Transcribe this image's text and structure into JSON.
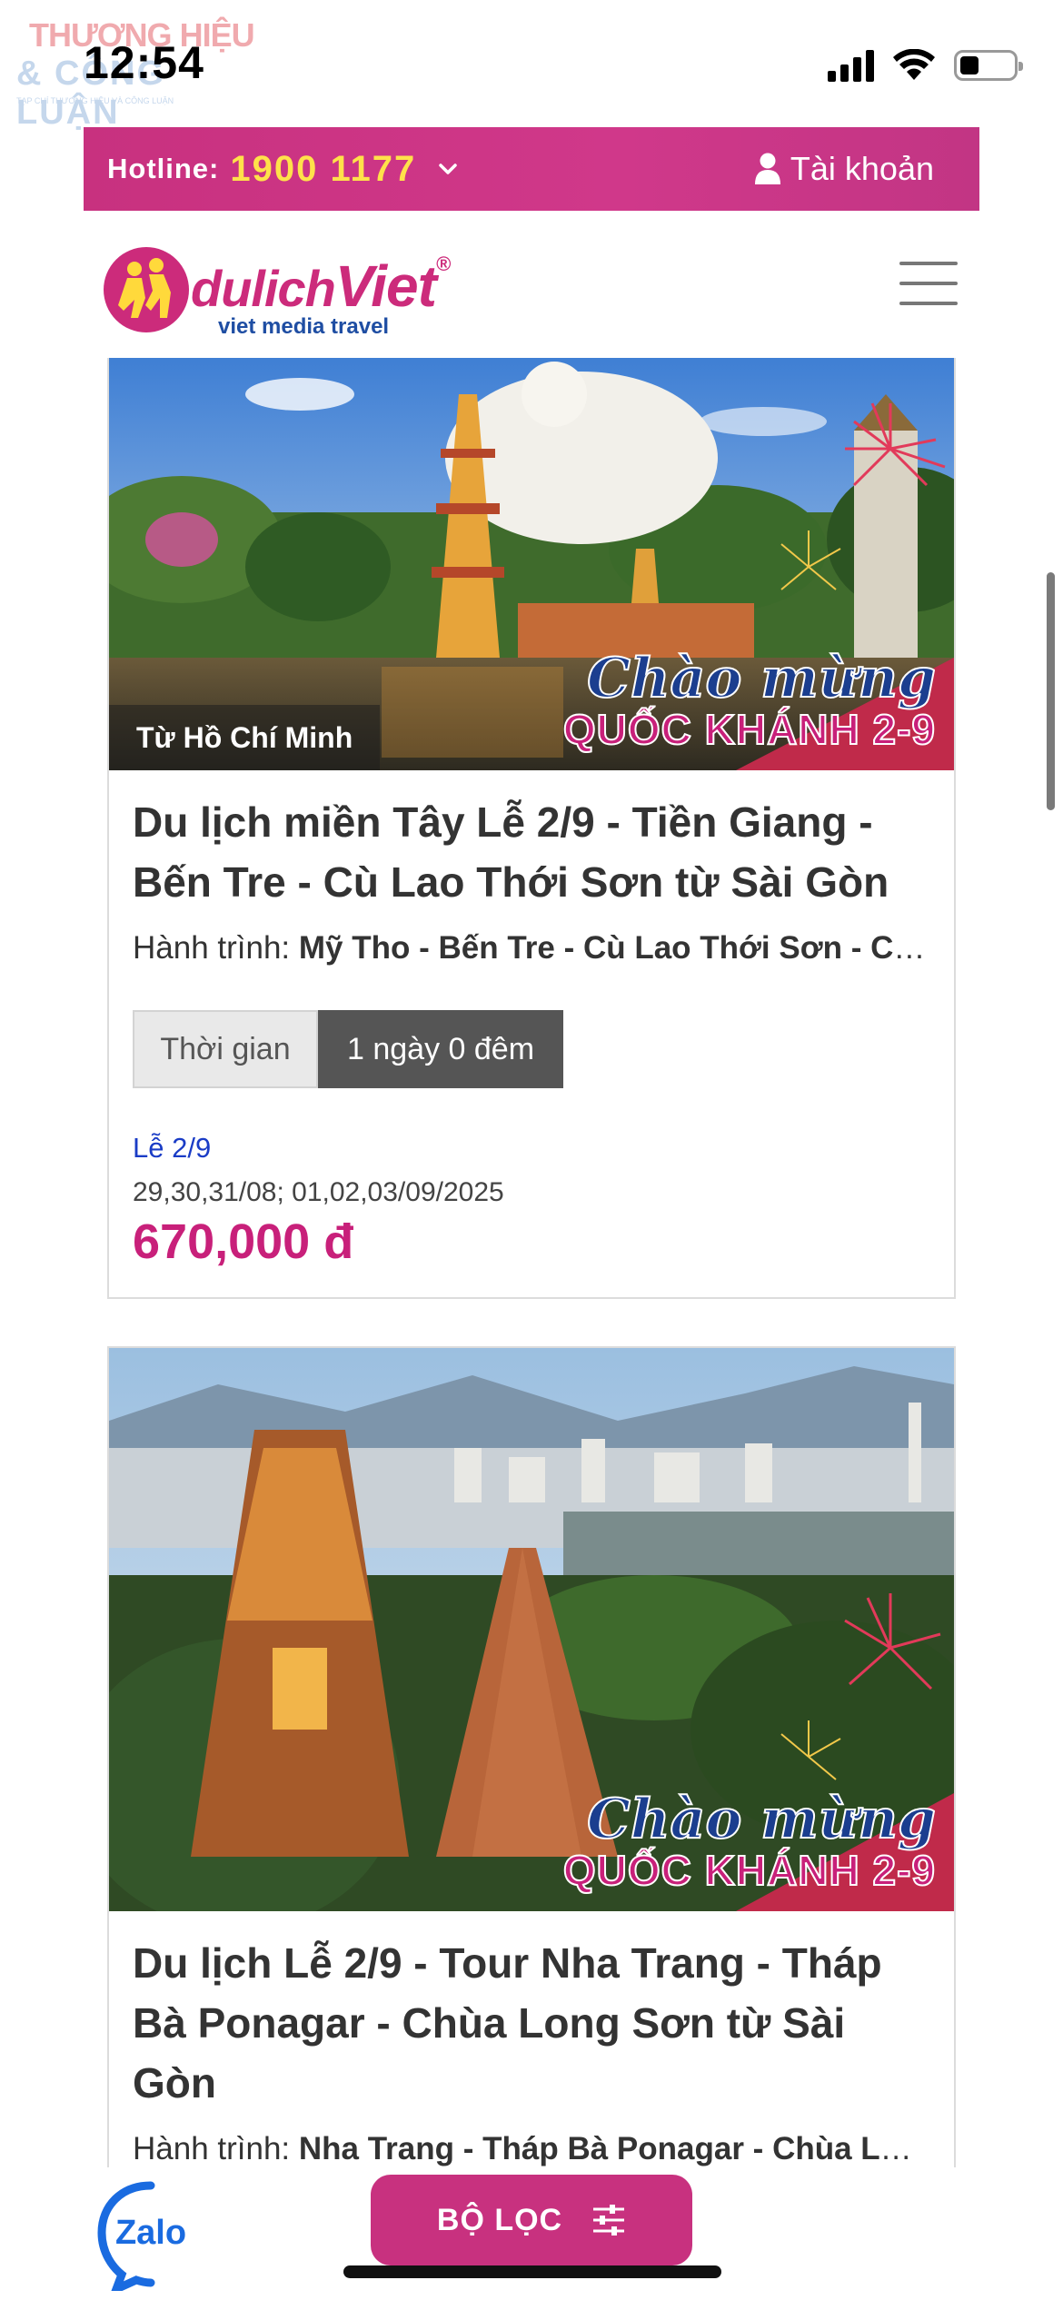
{
  "status_bar": {
    "time": "12:54",
    "watermark_line1": "THƯƠNG HIỆU",
    "watermark_line2": "& CÔNG LUẬN",
    "watermark_line3": "TẠP CHÍ THƯƠNG HIỆU VÀ CÔNG LUẬN",
    "battery_level": 0.35
  },
  "header": {
    "hotline_label": "Hotline:",
    "hotline_number": "1900 1177",
    "account_label": "Tài khoản",
    "logo_text_1": "dulich",
    "logo_text_2": "Viet",
    "logo_reg": "®",
    "logo_sub": "viet media travel"
  },
  "tours": [
    {
      "origin": "Từ Hồ Chí Minh",
      "promo_script": "Chào mừng",
      "promo_main": "QUỐC KHÁNH 2-9",
      "title": "Du lịch miền Tây Lễ 2/9 - Tiền Giang - Bến Tre - Cù Lao Thới Sơn từ Sài Gòn",
      "route_label": "Hành trình:",
      "route": "Mỹ Tho - Bến Tre - Cù Lao Thới Sơn - Cần Thơ",
      "duration_label": "Thời gian",
      "duration_value": "1 ngày 0 đêm",
      "holiday": "Lễ 2/9",
      "dates": "29,30,31/08; 01,02,03/09/2025",
      "price": "670,000 đ"
    },
    {
      "promo_script": "Chào mừng",
      "promo_main": "QUỐC KHÁNH 2-9",
      "title": "Du lịch Lễ 2/9 - Tour Nha Trang - Tháp Bà Ponagar - Chùa Long Sơn từ Sài Gòn",
      "route_label": "Hành trình:",
      "route": "Nha Trang - Tháp Bà Ponagar - Chùa Long Sơn"
    }
  ],
  "bottom": {
    "zalo_label": "Zalo",
    "filter_label": "BỘ LỌC"
  },
  "colors": {
    "brand_pink": "#c8317f",
    "hotline_yellow": "#ffe14a",
    "holiday_blue": "#1a3cc6"
  }
}
